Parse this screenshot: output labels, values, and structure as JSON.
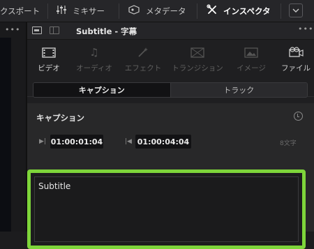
{
  "topbar": {
    "items": [
      {
        "label": "クスポート",
        "icon": ""
      },
      {
        "label": "ミキサー",
        "icon": "mixer-icon"
      },
      {
        "label": "メタデータ",
        "icon": "metadata-icon"
      },
      {
        "label": "インスペクタ",
        "icon": "inspector-icon",
        "active": true
      }
    ],
    "chevron": "chevron-down-icon"
  },
  "inspector": {
    "title": "Subtitle - 字幕",
    "tabs": [
      {
        "label": "ビデオ",
        "icon": "video-icon",
        "active": true
      },
      {
        "label": "オーディオ",
        "icon": "audio-icon"
      },
      {
        "label": "エフェクト",
        "icon": "effects-icon"
      },
      {
        "label": "トランジション",
        "icon": "transition-icon"
      },
      {
        "label": "イメージ",
        "icon": "image-icon"
      },
      {
        "label": "ファイル",
        "icon": "file-icon"
      }
    ],
    "segments": [
      "キャプション",
      "トラック"
    ],
    "section": {
      "title": "キャプション",
      "in_timecode": "01:00:01:04",
      "out_timecode": "01:00:04:04",
      "char_count": "8文字",
      "caption_text": "Subtitle"
    }
  },
  "colors": {
    "accent": "#e0463e",
    "highlight": "#7ed53a"
  }
}
